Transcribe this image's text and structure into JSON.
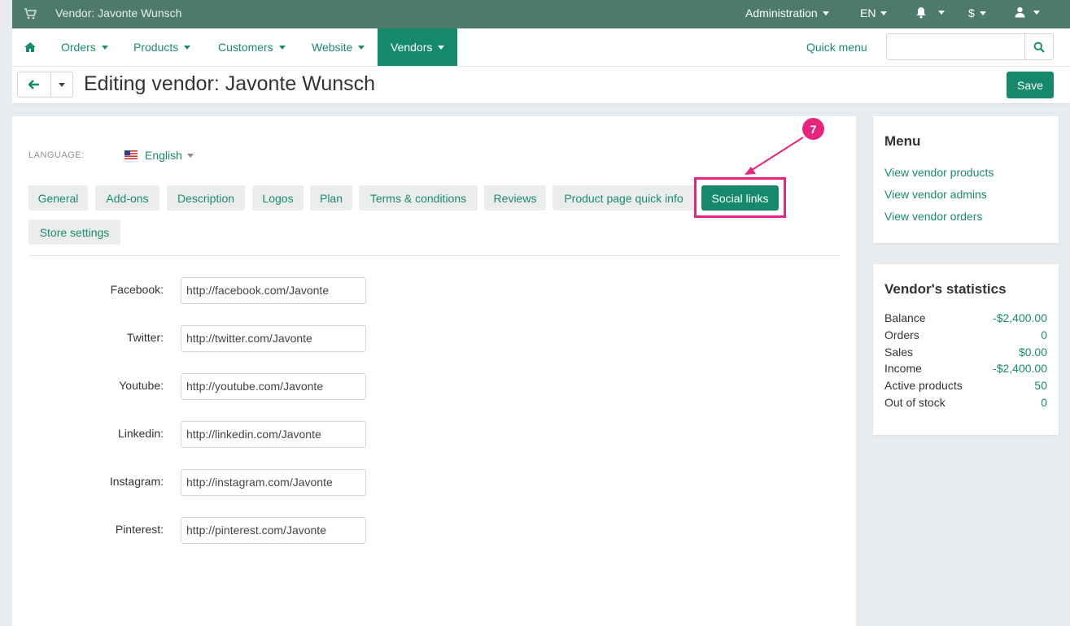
{
  "topbar": {
    "vendor_title": "Vendor: Javonte Wunsch",
    "administration": "Administration",
    "language": "EN",
    "currency": "$"
  },
  "nav": {
    "orders": "Orders",
    "products": "Products",
    "customers": "Customers",
    "website": "Website",
    "vendors": "Vendors",
    "quick_menu": "Quick menu",
    "search_placeholder": ""
  },
  "header": {
    "title": "Editing vendor: Javonte Wunsch",
    "save_label": "Save"
  },
  "language": {
    "label": "LANGUAGE:",
    "value": "English"
  },
  "tabs": [
    {
      "label": "General"
    },
    {
      "label": "Add-ons"
    },
    {
      "label": "Description"
    },
    {
      "label": "Logos"
    },
    {
      "label": "Plan"
    },
    {
      "label": "Terms & conditions"
    },
    {
      "label": "Reviews"
    },
    {
      "label": "Product page quick info"
    },
    {
      "label": "Social links",
      "active": true
    },
    {
      "label": "Store settings"
    }
  ],
  "annotation": {
    "step": "7"
  },
  "social_fields": [
    {
      "label": "Facebook:",
      "value": "http://facebook.com/Javonte"
    },
    {
      "label": "Twitter:",
      "value": "http://twitter.com/Javonte"
    },
    {
      "label": "Youtube:",
      "value": "http://youtube.com/Javonte"
    },
    {
      "label": "Linkedin:",
      "value": "http://linkedin.com/Javonte"
    },
    {
      "label": "Instagram:",
      "value": "http://instagram.com/Javonte"
    },
    {
      "label": "Pinterest:",
      "value": "http://pinterest.com/Javonte"
    }
  ],
  "menu": {
    "title": "Menu",
    "links": [
      "View vendor products",
      "View vendor admins",
      "View vendor orders"
    ]
  },
  "stats": {
    "title": "Vendor's statistics",
    "rows": [
      {
        "label": "Balance",
        "value": "-$2,400.00"
      },
      {
        "label": "Orders",
        "value": "0"
      },
      {
        "label": "Sales",
        "value": "$0.00"
      },
      {
        "label": "Income",
        "value": "-$2,400.00"
      },
      {
        "label": "Active products",
        "value": "50"
      },
      {
        "label": "Out of stock",
        "value": "0"
      }
    ]
  },
  "colors": {
    "topbar": "#4e7a6b",
    "accent": "#16896c",
    "highlight": "#e6267e"
  },
  "icons": [
    "cart-icon",
    "home-icon",
    "bell-icon",
    "user-icon",
    "search-icon",
    "back-arrow-icon",
    "flag-us-icon"
  ]
}
